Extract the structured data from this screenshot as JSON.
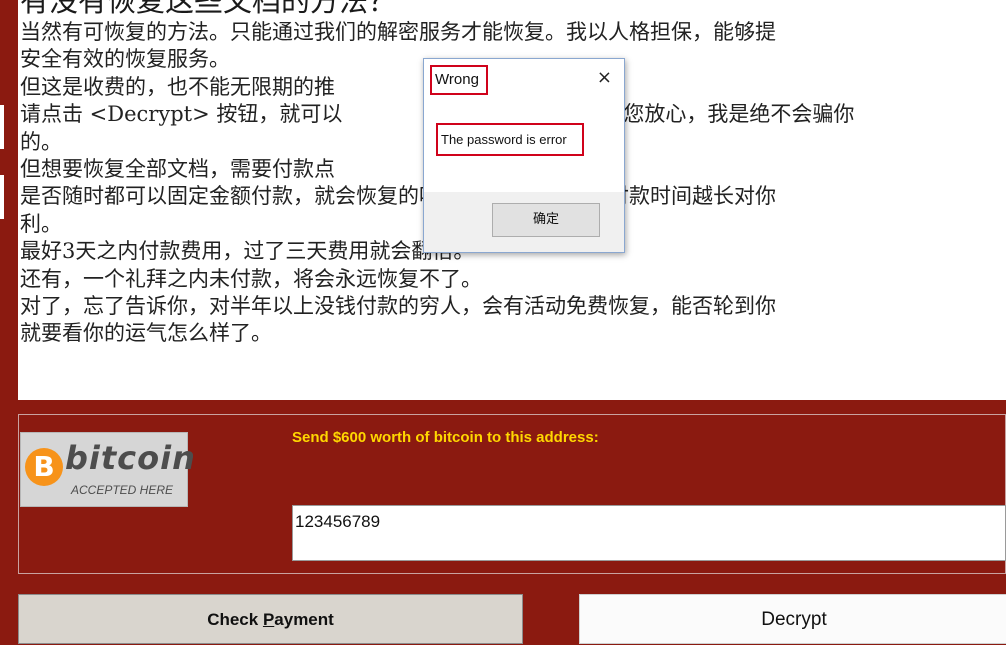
{
  "content": {
    "heading": "有没有恢复这些文档的方法？",
    "lines": [
      "当然有可恢复的方法。只能通过我们的解密服务才能恢复。我以人格担保，能够提",
      "安全有效的恢复服务。",
      "但这是收费的，也不能无限期的推",
      "请点击 <Decrypt> 按钮，就可以",
      "的。",
      "但想要恢复全部文档，需要付款点",
      "是否随时都可以固定金额付款，就",
      "利。",
      "最好3天之内付款费用，过了三天费用就会翻倍。",
      "还有，一个礼拜之内未付款，将会永远恢复不了。",
      "对了，忘了告诉你，对半年以上没钱付款的穷人，会有活动免费恢复，能否轮到你",
      "就要看你的运气怎么样了。"
    ],
    "line_tails": [
      "",
      "",
      "",
      "档。请您放心，我是绝不会骗你",
      "",
      "",
      "会恢复的吗　当然不是，推迟付款时间越长对你",
      "",
      "",
      "",
      "",
      ""
    ]
  },
  "bitcoin": {
    "logo_word": "bitcoin",
    "logo_coin": "B",
    "logo_sub": "ACCEPTED HERE",
    "send_label": "Send $600 worth of bitcoin to this address:",
    "address": "123456789"
  },
  "buttons": {
    "check_prefix": "Check ",
    "check_underlined": "P",
    "check_suffix": "ayment",
    "decrypt": "Decrypt"
  },
  "dialog": {
    "title": "Wrong",
    "close": "×",
    "message": "The password is error",
    "ok": "确定"
  },
  "colors": {
    "background": "#8b1a10",
    "send_label": "#ffd700",
    "highlight_box": "#d0021b",
    "bitcoin_orange": "#f7931a"
  }
}
